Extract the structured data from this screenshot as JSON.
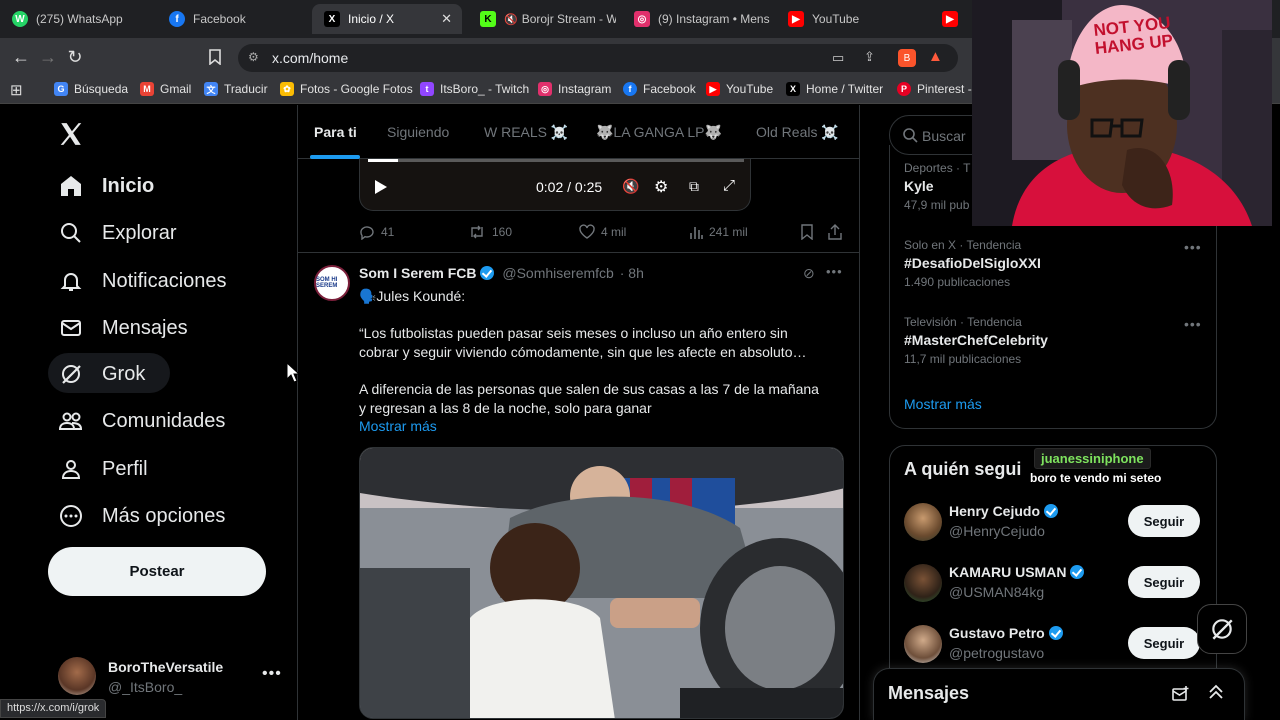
{
  "browser": {
    "tabs": [
      {
        "label": "(275) WhatsApp",
        "color": "#25d366",
        "glyph": "W"
      },
      {
        "label": "Facebook",
        "color": "#1877f2",
        "glyph": "f"
      },
      {
        "label": "Inicio / X",
        "color": "#000000",
        "glyph": "X",
        "active": true
      },
      {
        "label": "Borojr Stream - W",
        "color": "#53fc18",
        "glyph": "K"
      },
      {
        "label": "(9) Instagram • Mens",
        "color": "#e1306c",
        "glyph": "◎"
      },
      {
        "label": "YouTube",
        "color": "#ff0000",
        "glyph": "▶"
      }
    ],
    "url": "x.com/home",
    "status_url": "https://x.com/i/grok",
    "bookmarks": [
      {
        "label": "Búsqueda",
        "color": "#4285f4",
        "glyph": "G"
      },
      {
        "label": "Gmail",
        "color": "#ea4335",
        "glyph": "M"
      },
      {
        "label": "Traducir",
        "color": "#4285f4",
        "glyph": "文"
      },
      {
        "label": "Fotos - Google Fotos",
        "color": "#fbbc04",
        "glyph": "✿"
      },
      {
        "label": "ItsBoro_ - Twitch",
        "color": "#9146ff",
        "glyph": "t"
      },
      {
        "label": "Instagram",
        "color": "#e1306c",
        "glyph": "◎"
      },
      {
        "label": "Facebook",
        "color": "#1877f2",
        "glyph": "f"
      },
      {
        "label": "YouTube",
        "color": "#ff0000",
        "glyph": "▶"
      },
      {
        "label": "Home / Twitter",
        "color": "#000000",
        "glyph": "X"
      },
      {
        "label": "Pinterest - I",
        "color": "#e60023",
        "glyph": "P"
      }
    ]
  },
  "sidebar": {
    "items": [
      {
        "label": "Inicio",
        "icon": "home-icon"
      },
      {
        "label": "Explorar",
        "icon": "search-icon"
      },
      {
        "label": "Notificaciones",
        "icon": "bell-icon"
      },
      {
        "label": "Mensajes",
        "icon": "mail-icon"
      },
      {
        "label": "Grok",
        "icon": "grok-icon"
      },
      {
        "label": "Comunidades",
        "icon": "communities-icon"
      },
      {
        "label": "Perfil",
        "icon": "person-icon"
      },
      {
        "label": "Más opciones",
        "icon": "more-circle-icon"
      }
    ],
    "post_label": "Postear",
    "account": {
      "name": "BoroTheVersatile",
      "handle": "@_ItsBoro_"
    }
  },
  "feed": {
    "tabs": [
      "Para ti",
      "Siguiendo",
      "W REALS ☠️",
      "🐺LA GANGA LP🐺",
      "Old Reals ☠️"
    ],
    "video": {
      "time": "0:02 / 0:25",
      "progress": 0.08
    },
    "tweet1_stats": {
      "replies": "41",
      "reposts": "160",
      "likes": "4 mil",
      "views": "241 mil"
    },
    "tweet2": {
      "author": "Som I Serem FCB",
      "handle": "@Somhiseremfcb",
      "time": "· 8h",
      "avatar_text": "SOM HI SEREM",
      "line1": "🗣️Jules Koundé:",
      "para1": "“Los futbolistas pueden pasar seis meses o incluso un año entero sin cobrar y seguir viviendo cómodamente, sin que les afecte en absoluto…",
      "para2": "A diferencia de las personas que salen de sus casas a las 7 de la mañana y regresan a las 8 de la noche, solo para ganar",
      "show_more": "Mostrar más"
    }
  },
  "right": {
    "search_placeholder": "Buscar",
    "trends": [
      {
        "meta": "Deportes · T",
        "name": "Kyle",
        "count": "47,9 mil pub"
      },
      {
        "meta": "Solo en X · Tendencia",
        "name": "#DesafioDelSigloXXI",
        "count": "1.490 publicaciones"
      },
      {
        "meta": "Televisión · Tendencia",
        "name": "#MasterChefCelebrity",
        "count": "11,7 mil publicaciones"
      }
    ],
    "show_more": "Mostrar más",
    "who_to_follow_title": "A quién segui",
    "suggestions": [
      {
        "name": "Henry Cejudo",
        "handle": "@HenryCejudo",
        "button": "Seguir"
      },
      {
        "name": "KAMARU USMAN",
        "handle": "@USMAN84kg",
        "button": "Seguir"
      },
      {
        "name": "Gustavo Petro",
        "handle": "@petrogustavo",
        "button": "Seguir"
      }
    ],
    "messages_label": "Mensajes"
  },
  "chat_overlay": {
    "user": "juanessiniphone",
    "message": "boro te vendo mi seteo"
  },
  "webcam": {
    "hat_text": "NOT YOU HANG UP"
  },
  "colors": {
    "accent": "#1d9bf0",
    "bg": "#000000",
    "border": "#2f3336",
    "muted": "#71767b"
  }
}
